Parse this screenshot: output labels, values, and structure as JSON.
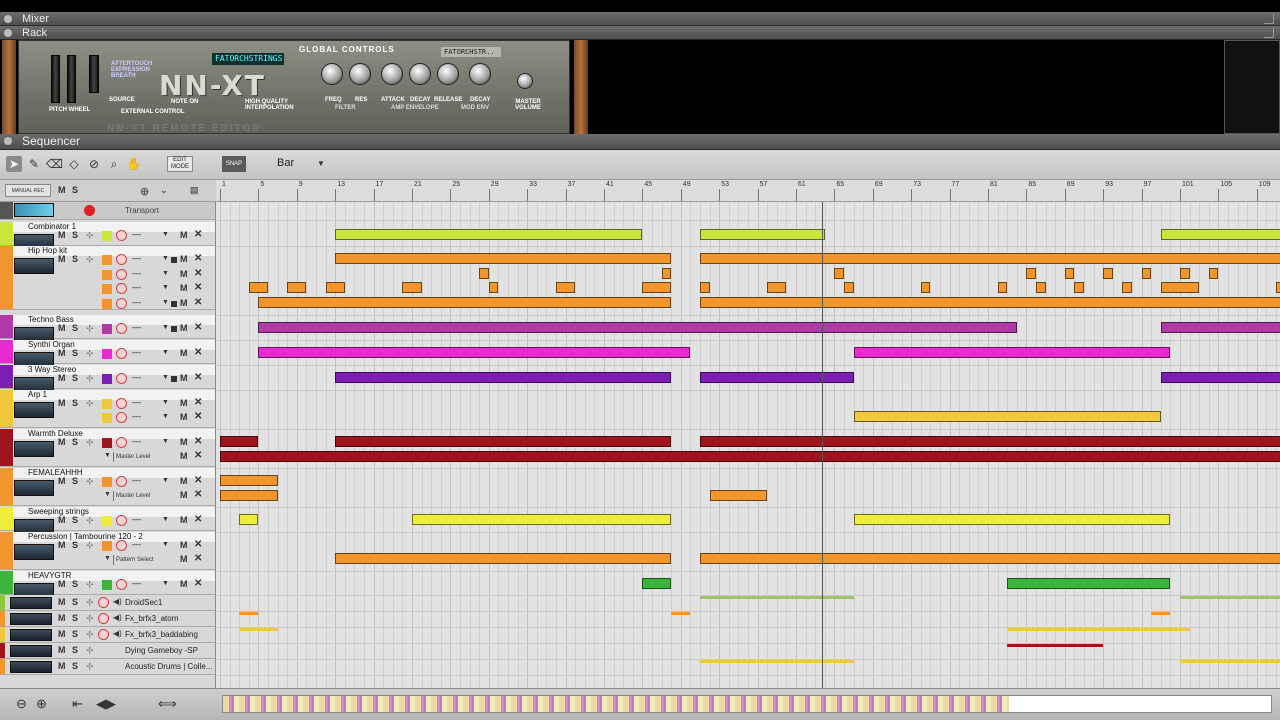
{
  "panels": {
    "mixer": "Mixer",
    "rack": "Rack",
    "sequencer": "Sequencer"
  },
  "rack": {
    "device_name": "NN-XT",
    "patch_display": "FATORCHSTRINGS",
    "patch_display2": "FATORCHSTR..",
    "global_controls": "GLOBAL CONTROLS",
    "remote_editor": "NN-XT  REMOTE EDITOR",
    "knobs": [
      "FREQ",
      "RES",
      "ATTACK",
      "DECAY",
      "RELEASE",
      "DECAY"
    ],
    "sections": [
      "FILTER",
      "AMP ENVELOPE",
      "MOD ENV"
    ],
    "master_volume": "MASTER VOLUME",
    "wheel_labels": [
      "PITCH",
      "WHEEL"
    ],
    "external": [
      "AFTERTOUCH",
      "EXPRESSION",
      "BREATH"
    ],
    "source": "SOURCE",
    "external_control": "EXTERNAL CONTROL",
    "note_on": "NOTE ON",
    "hq_interp": "HIGH QUALITY INTERPOLATION"
  },
  "toolbar": {
    "edit_mode": "EDIT MODE",
    "snap": "SNAP",
    "snap_value": "Bar"
  },
  "track_header": {
    "manual_rec": "MANUAL REC",
    "m": "M",
    "s": "S"
  },
  "ruler_bars": [
    "1",
    "5",
    "9",
    "13",
    "17",
    "21",
    "25",
    "29",
    "33",
    "37",
    "41",
    "45",
    "49",
    "53",
    "57",
    "61",
    "65",
    "69",
    "73",
    "77",
    "81",
    "85",
    "89",
    "93",
    "97",
    "101",
    "105",
    "109"
  ],
  "tracks": {
    "transport": "Transport",
    "combinator": "Combinator 1",
    "hiphop": "Hip Hop kit",
    "techno_bass": "Techno Bass",
    "synth_organ": "Synthi Organ",
    "three_way": "3 Way Stereo",
    "arp": "Arp 1",
    "warmth": "Warmth Deluxe",
    "female": "FEMALEAHHH",
    "sweeping": "Sweeping strings",
    "percussion": "Percussion | Tambourine  120 - 2",
    "heavygtr": "HEAVYGTR",
    "droid": "DroidSec1",
    "fx_atom": "Fx_brfx3_atom",
    "fx_bad": "Fx_brfx3_baddabing",
    "gameboy": "Dying Gameboy  -SP",
    "acoustic": "Acoustic Drums | Colle..."
  },
  "param_labels": {
    "master_level": "Master Level",
    "pattern_select": "Pattern Select"
  },
  "lane_labels": {
    "m": "M",
    "s": "S",
    "mute": "M",
    "del": "✕",
    "dash": "—"
  },
  "colors": {
    "lime": "#c8e63c",
    "orange": "#f0962d",
    "purple_pink": "#b03aa8",
    "magenta": "#e82ad0",
    "violet": "#7a1eb4",
    "yellow": "#f0c83c",
    "darkred": "#a0141e",
    "yellow_bright": "#f0ec3c",
    "green": "#3cb43c"
  },
  "icons": [
    "select-tool",
    "pencil-tool",
    "eraser-tool",
    "razor-tool",
    "mute-tool",
    "magnify-tool",
    "hand-tool"
  ]
}
